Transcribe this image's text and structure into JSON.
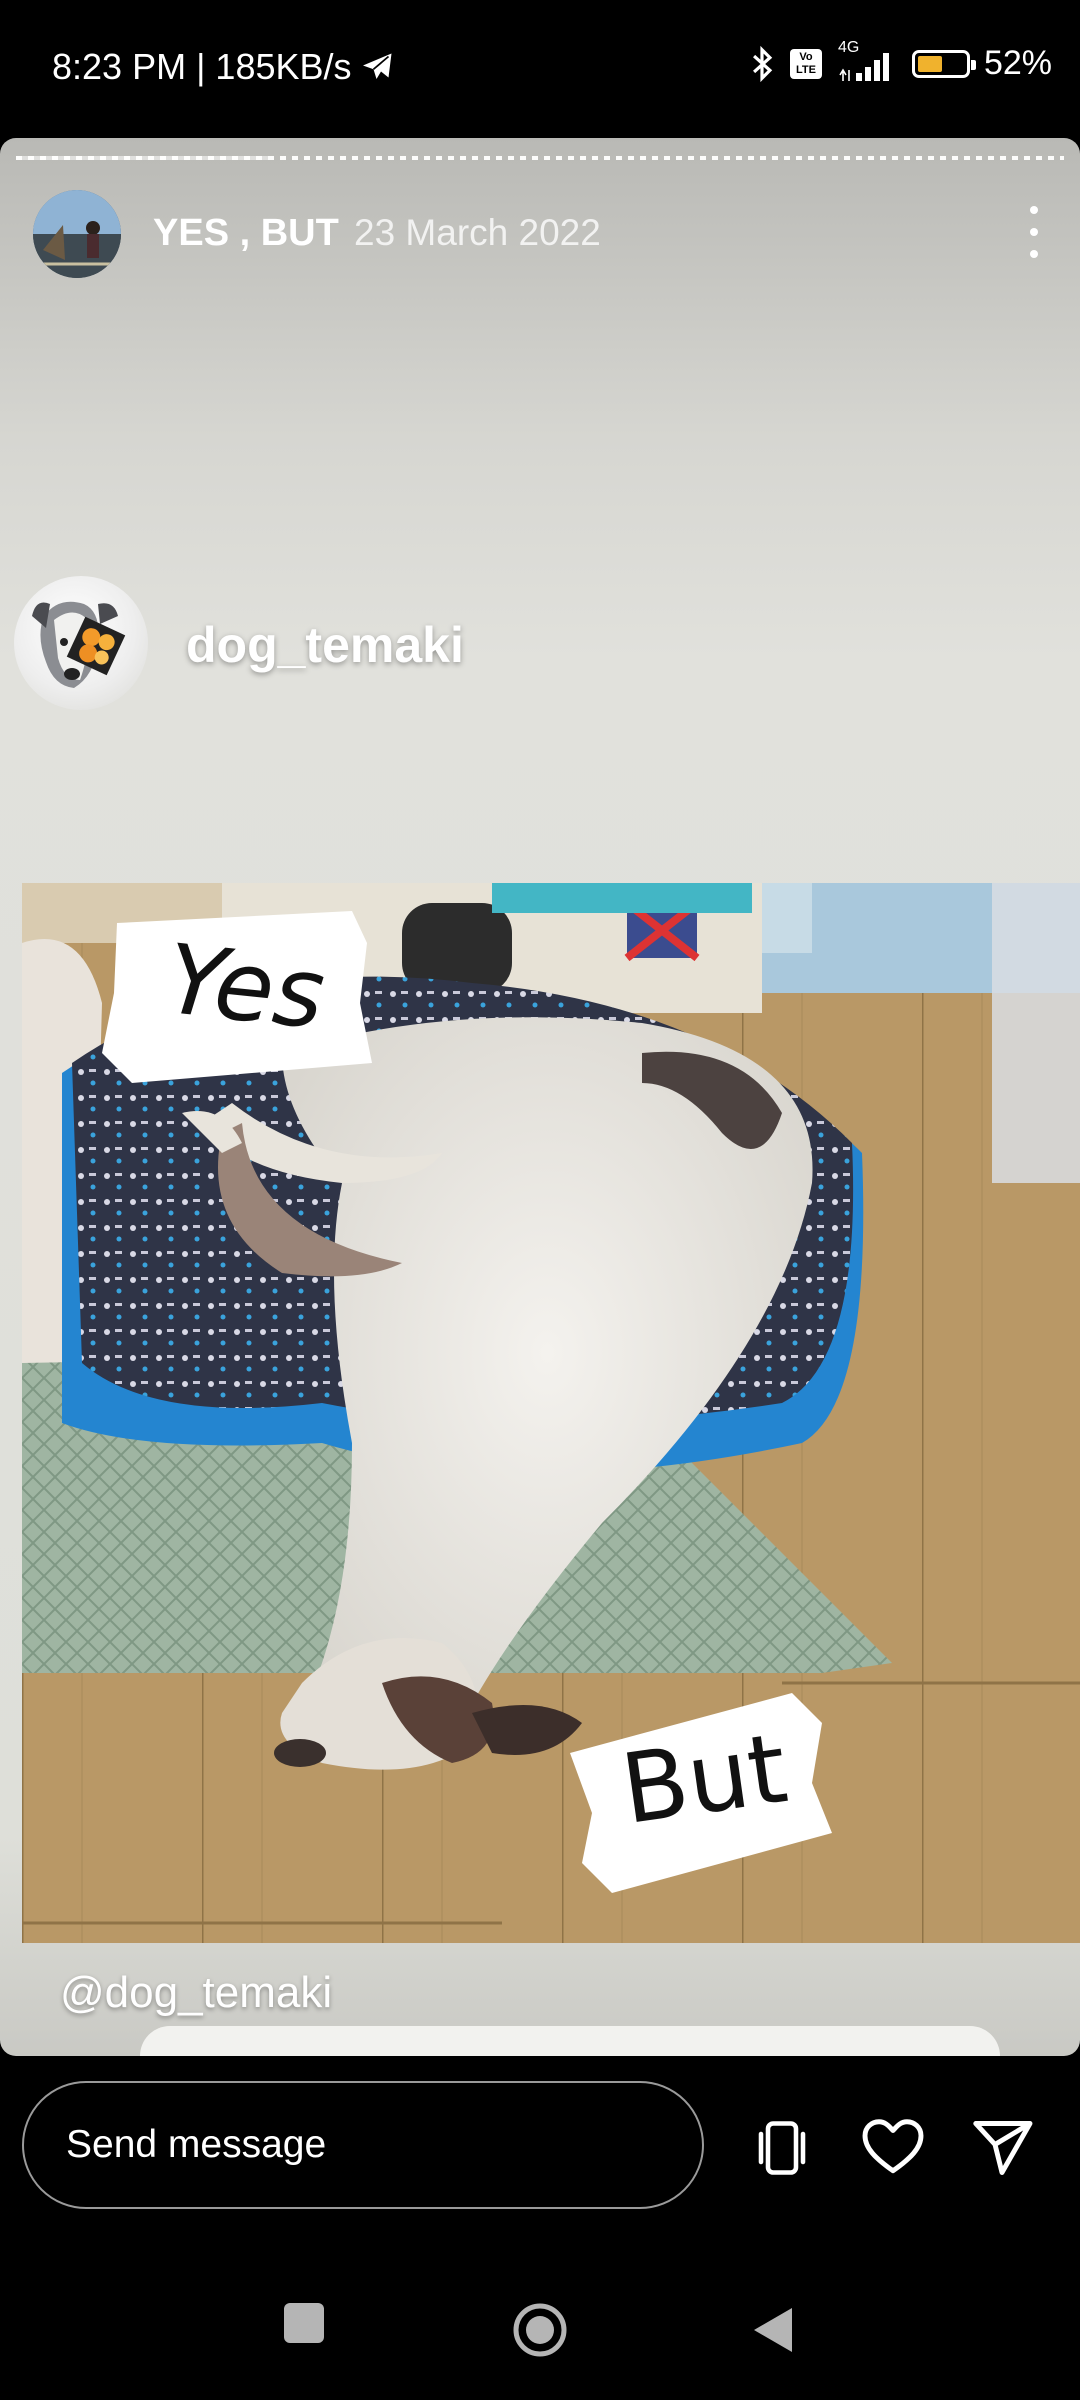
{
  "status_bar": {
    "time_speed": "8:23 PM | 185KB/s",
    "network": "4G",
    "volte": "Vo LTE",
    "battery_text": "52%",
    "battery_level": 0.52,
    "icons": [
      "telegram-icon",
      "bluetooth-icon",
      "volte-icon",
      "signal-icon",
      "battery-icon"
    ]
  },
  "story": {
    "progress": 0.24,
    "account_name": "YES , BUT",
    "date": "23 March 2022",
    "post_username": "dog_temaki",
    "mention": "@dog_temaki",
    "caption_yes": "Yes",
    "caption_but": "But"
  },
  "reply_bar": {
    "placeholder": "Send message",
    "icons": [
      "shake-icon",
      "heart-icon",
      "send-icon"
    ]
  },
  "nav_bar": {
    "icons": [
      "recents-square-icon",
      "home-circle-icon",
      "back-triangle-icon"
    ]
  },
  "colors": {
    "battery_fill": "#f0b22d",
    "background": "#000000"
  }
}
